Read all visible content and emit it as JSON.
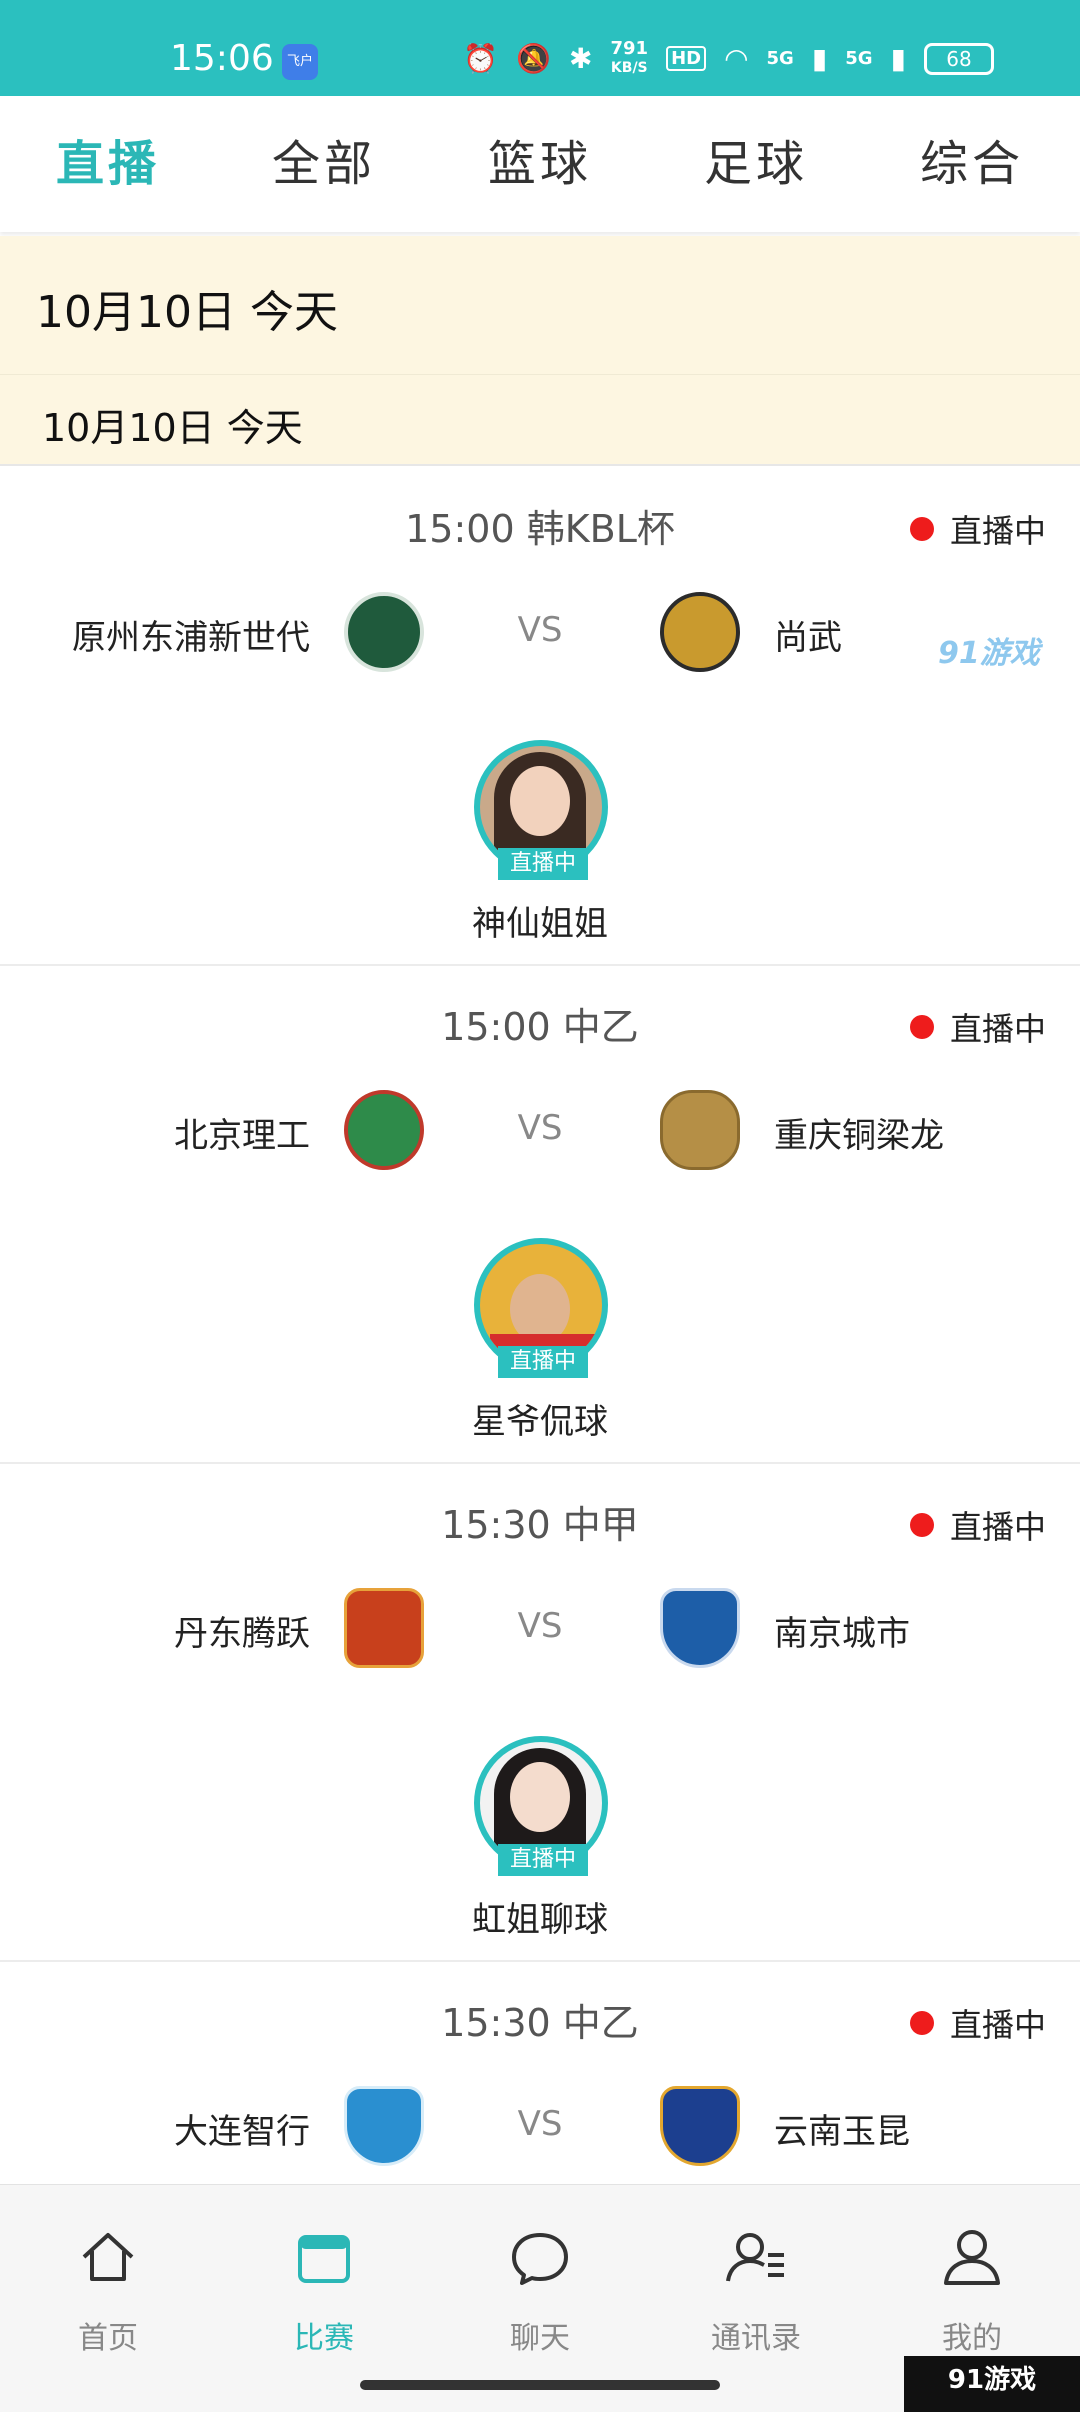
{
  "status_bar": {
    "time": "15:06",
    "app_badge": "飞户",
    "speed_value": "791",
    "speed_unit": "KB/S",
    "hd_label": "HD",
    "net1": "5G",
    "net2": "5G",
    "battery": "68"
  },
  "category_tabs": [
    {
      "label": "直播",
      "active": true
    },
    {
      "label": "全部",
      "active": false
    },
    {
      "label": "篮球",
      "active": false
    },
    {
      "label": "足球",
      "active": false
    },
    {
      "label": "综合",
      "active": false
    }
  ],
  "date_header": "10月10日  今天",
  "date_sub_header": "10月10日   今天",
  "vs_label": "VS",
  "live_label": "直播中",
  "matches": [
    {
      "time": "15:00",
      "league": "韩KBL杯",
      "header": "15:00  韩KBL杯",
      "home": "原州东浦新世代",
      "away": "尚武",
      "streamer": "神仙姐姐",
      "home_logo_color": "#1f5a3c",
      "away_logo_color": "#c99a2e"
    },
    {
      "time": "15:00",
      "league": "中乙",
      "header": "15:00  中乙",
      "home": "北京理工",
      "away": "重庆铜梁龙",
      "streamer": "星爷侃球",
      "home_logo_color": "#2e8b4a",
      "away_logo_color": "#b58f46"
    },
    {
      "time": "15:30",
      "league": "中甲",
      "header": "15:30  中甲",
      "home": "丹东腾跃",
      "away": "南京城市",
      "streamer": "虹姐聊球",
      "home_logo_color": "#c8401c",
      "away_logo_color": "#1d5ea8"
    },
    {
      "time": "15:30",
      "league": "中乙",
      "header": "15:30  中乙",
      "home": "大连智行",
      "away": "云南玉昆",
      "home_logo_color": "#2a8fd0",
      "away_logo_color": "#1c3f8f"
    }
  ],
  "watermark_small": "91游戏",
  "bottom_nav": [
    {
      "label": "首页",
      "icon": "home-icon",
      "active": false
    },
    {
      "label": "比赛",
      "icon": "calendar-icon",
      "active": true
    },
    {
      "label": "聊天",
      "icon": "chat-icon",
      "active": false
    },
    {
      "label": "通讯录",
      "icon": "contacts-icon",
      "active": false
    },
    {
      "label": "我的",
      "icon": "profile-icon",
      "active": false
    }
  ],
  "corner_watermark": "91游戏",
  "colors": {
    "accent": "#2bc0bf",
    "live_dot": "#ee1c1c",
    "date_bg": "#fdf6e1"
  }
}
